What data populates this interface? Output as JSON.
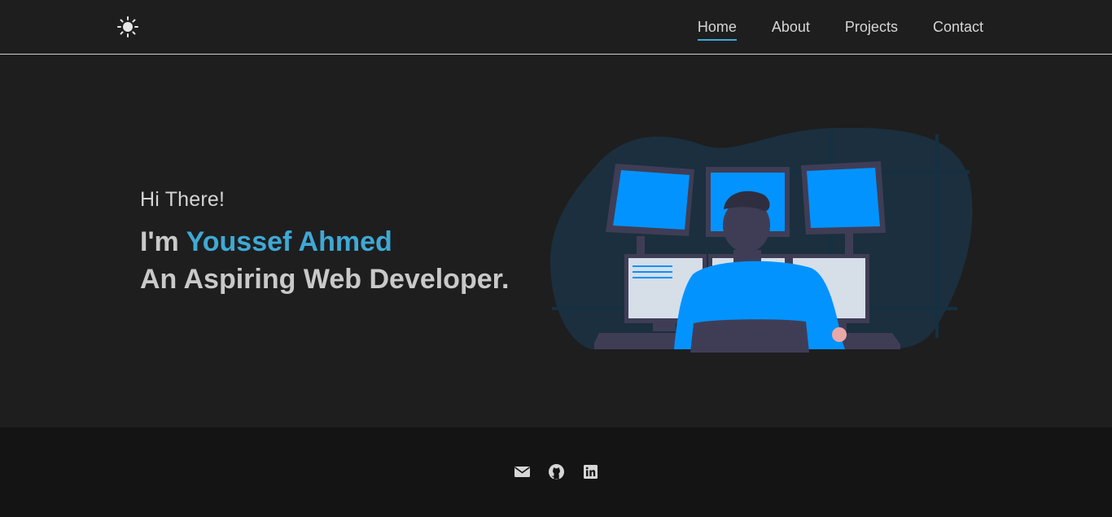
{
  "nav": {
    "theme_toggle_icon": "sun-icon",
    "links": [
      {
        "label": "Home",
        "active": true
      },
      {
        "label": "About",
        "active": false
      },
      {
        "label": "Projects",
        "active": false
      },
      {
        "label": "Contact",
        "active": false
      }
    ]
  },
  "hero": {
    "greeting": "Hi There!",
    "intro_prefix": "I'm ",
    "name": "Youssef Ahmed",
    "tagline": "An Aspiring Web Developer.",
    "illustration": "developer-at-monitors-illustration"
  },
  "footer": {
    "social_icons": [
      "envelope-icon",
      "github-icon",
      "linkedin-icon"
    ]
  },
  "colors": {
    "background": "#1e1e1f",
    "footer_background": "#141414",
    "accent": "#3fa9d5",
    "text": "#c9c9c9",
    "screen_blue": "#0393ff"
  }
}
